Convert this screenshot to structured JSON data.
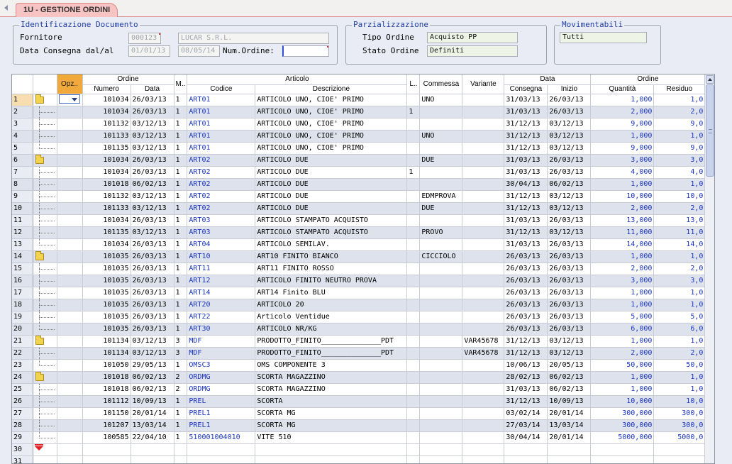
{
  "tab": {
    "title": "1U - GESTIONE ORDINI"
  },
  "ident": {
    "legend": "Identificazione Documento",
    "fornitore_label": "Fornitore",
    "fornitore_code": "000123",
    "fornitore_name": "LUCAR S.R.L.",
    "data_label": "Data Consegna dal/al",
    "data_dal": "01/01/13",
    "data_al": "08/05/14",
    "num_ordine_label": "Num.Ordine:",
    "num_ordine": ""
  },
  "parz": {
    "legend": "Parzializzazione",
    "tipo_label": "Tipo Ordine",
    "tipo_value": "Acquisto PP",
    "stato_label": "Stato Ordine",
    "stato_value": "Definiti"
  },
  "mov": {
    "legend": "Movimentabili",
    "value": "Tutti"
  },
  "grid": {
    "group_headers": {
      "ordine": "Ordine",
      "m": "M..",
      "articolo": "Articolo",
      "l": "L..",
      "commessa": "Commessa",
      "variante": "Variante",
      "data": "Data",
      "ordine2": "Ordine"
    },
    "headers": {
      "opz": "Opz..",
      "numero": "Numero",
      "data": "Data",
      "codice": "Codice",
      "descrizione": "Descrizione",
      "consegna": "Consegna",
      "inizio": "Inizio",
      "quantita": "Quantità",
      "residuo": "Residuo"
    },
    "rows": [
      {
        "n": "1",
        "folder": true,
        "numero": "101034",
        "data": "26/03/13",
        "m": "1",
        "codice": "ART01",
        "descr": "ARTICOLO UNO, CIOE' PRIMO",
        "l": "",
        "commessa": "UNO",
        "variante": "",
        "consegna": "31/03/13",
        "inizio": "26/03/13",
        "qta": "1,000",
        "res": "1,0"
      },
      {
        "n": "2",
        "folder": false,
        "numero": "101034",
        "data": "26/03/13",
        "m": "1",
        "codice": "ART01",
        "descr": "ARTICOLO UNO, CIOE' PRIMO",
        "l": "1",
        "commessa": "",
        "variante": "",
        "consegna": "31/03/13",
        "inizio": "26/03/13",
        "qta": "2,000",
        "res": "2,0"
      },
      {
        "n": "3",
        "folder": false,
        "numero": "101132",
        "data": "03/12/13",
        "m": "1",
        "codice": "ART01",
        "descr": "ARTICOLO UNO, CIOE' PRIMO",
        "l": "",
        "commessa": "",
        "variante": "",
        "consegna": "31/12/13",
        "inizio": "03/12/13",
        "qta": "9,000",
        "res": "9,0"
      },
      {
        "n": "4",
        "folder": false,
        "numero": "101133",
        "data": "03/12/13",
        "m": "1",
        "codice": "ART01",
        "descr": "ARTICOLO UNO, CIOE' PRIMO",
        "l": "",
        "commessa": "UNO",
        "variante": "",
        "consegna": "31/12/13",
        "inizio": "03/12/13",
        "qta": "1,000",
        "res": "1,0"
      },
      {
        "n": "5",
        "folder": false,
        "numero": "101135",
        "data": "03/12/13",
        "m": "1",
        "codice": "ART01",
        "descr": "ARTICOLO UNO, CIOE' PRIMO",
        "l": "",
        "commessa": "",
        "variante": "",
        "consegna": "31/12/13",
        "inizio": "03/12/13",
        "qta": "9,000",
        "res": "9,0"
      },
      {
        "n": "6",
        "folder": true,
        "numero": "101034",
        "data": "26/03/13",
        "m": "1",
        "codice": "ART02",
        "descr": "ARTICOLO DUE",
        "l": "",
        "commessa": "DUE",
        "variante": "",
        "consegna": "31/03/13",
        "inizio": "26/03/13",
        "qta": "3,000",
        "res": "3,0"
      },
      {
        "n": "7",
        "folder": false,
        "numero": "101034",
        "data": "26/03/13",
        "m": "1",
        "codice": "ART02",
        "descr": "ARTICOLO DUE",
        "l": "1",
        "commessa": "",
        "variante": "",
        "consegna": "31/03/13",
        "inizio": "26/03/13",
        "qta": "4,000",
        "res": "4,0"
      },
      {
        "n": "8",
        "folder": false,
        "numero": "101018",
        "data": "06/02/13",
        "m": "1",
        "codice": "ART02",
        "descr": "ARTICOLO DUE",
        "l": "",
        "commessa": "",
        "variante": "",
        "consegna": "30/04/13",
        "inizio": "06/02/13",
        "qta": "1,000",
        "res": "1,0"
      },
      {
        "n": "9",
        "folder": false,
        "numero": "101132",
        "data": "03/12/13",
        "m": "1",
        "codice": "ART02",
        "descr": "ARTICOLO DUE",
        "l": "",
        "commessa": "EDMPROVA",
        "variante": "",
        "consegna": "31/12/13",
        "inizio": "03/12/13",
        "qta": "10,000",
        "res": "10,0"
      },
      {
        "n": "10",
        "folder": false,
        "numero": "101133",
        "data": "03/12/13",
        "m": "1",
        "codice": "ART02",
        "descr": "ARTICOLO DUE",
        "l": "",
        "commessa": "DUE",
        "variante": "",
        "consegna": "31/12/13",
        "inizio": "03/12/13",
        "qta": "2,000",
        "res": "2,0"
      },
      {
        "n": "11",
        "folder": false,
        "numero": "101034",
        "data": "26/03/13",
        "m": "1",
        "codice": "ART03",
        "descr": "ARTICOLO STAMPATO ACQUISTO",
        "l": "",
        "commessa": "",
        "variante": "",
        "consegna": "31/03/13",
        "inizio": "26/03/13",
        "qta": "13,000",
        "res": "13,0"
      },
      {
        "n": "12",
        "folder": false,
        "numero": "101135",
        "data": "03/12/13",
        "m": "1",
        "codice": "ART03",
        "descr": "ARTICOLO STAMPATO ACQUISTO",
        "l": "",
        "commessa": "PROVO",
        "variante": "",
        "consegna": "31/12/13",
        "inizio": "03/12/13",
        "qta": "11,000",
        "res": "11,0"
      },
      {
        "n": "13",
        "folder": false,
        "numero": "101034",
        "data": "26/03/13",
        "m": "1",
        "codice": "ART04",
        "descr": "ARTICOLO SEMILAV.",
        "l": "",
        "commessa": "",
        "variante": "",
        "consegna": "31/03/13",
        "inizio": "26/03/13",
        "qta": "14,000",
        "res": "14,0"
      },
      {
        "n": "14",
        "folder": true,
        "numero": "101035",
        "data": "26/03/13",
        "m": "1",
        "codice": "ART10",
        "descr": "ART10 FINITO BIANCO",
        "l": "",
        "commessa": "CICCIOLO",
        "variante": "",
        "consegna": "26/03/13",
        "inizio": "26/03/13",
        "qta": "1,000",
        "res": "1,0"
      },
      {
        "n": "15",
        "folder": false,
        "numero": "101035",
        "data": "26/03/13",
        "m": "1",
        "codice": "ART11",
        "descr": "ART11 FINITO ROSSO",
        "l": "",
        "commessa": "",
        "variante": "",
        "consegna": "26/03/13",
        "inizio": "26/03/13",
        "qta": "2,000",
        "res": "2,0"
      },
      {
        "n": "16",
        "folder": false,
        "numero": "101035",
        "data": "26/03/13",
        "m": "1",
        "codice": "ART12",
        "descr": "ARTICOLO FINITO NEUTRO PROVA",
        "l": "",
        "commessa": "",
        "variante": "",
        "consegna": "26/03/13",
        "inizio": "26/03/13",
        "qta": "3,000",
        "res": "3,0"
      },
      {
        "n": "17",
        "folder": false,
        "numero": "101035",
        "data": "26/03/13",
        "m": "1",
        "codice": "ART14",
        "descr": "ART14 Finito BLU",
        "l": "",
        "commessa": "",
        "variante": "",
        "consegna": "26/03/13",
        "inizio": "26/03/13",
        "qta": "1,000",
        "res": "1,0"
      },
      {
        "n": "18",
        "folder": false,
        "numero": "101035",
        "data": "26/03/13",
        "m": "1",
        "codice": "ART20",
        "descr": "ARTICOLO 20",
        "l": "",
        "commessa": "",
        "variante": "",
        "consegna": "26/03/13",
        "inizio": "26/03/13",
        "qta": "1,000",
        "res": "1,0"
      },
      {
        "n": "19",
        "folder": false,
        "numero": "101035",
        "data": "26/03/13",
        "m": "1",
        "codice": "ART22",
        "descr": "Articolo Ventidue",
        "l": "",
        "commessa": "",
        "variante": "",
        "consegna": "26/03/13",
        "inizio": "26/03/13",
        "qta": "5,000",
        "res": "5,0"
      },
      {
        "n": "20",
        "folder": false,
        "numero": "101035",
        "data": "26/03/13",
        "m": "1",
        "codice": "ART30",
        "descr": "ARTICOLO NR/KG",
        "l": "",
        "commessa": "",
        "variante": "",
        "consegna": "26/03/13",
        "inizio": "26/03/13",
        "qta": "6,000",
        "res": "6,0"
      },
      {
        "n": "21",
        "folder": true,
        "numero": "101134",
        "data": "03/12/13",
        "m": "3",
        "codice": "MDF",
        "descr": "PRODOTTO_FINITO______________PDT",
        "l": "",
        "commessa": "",
        "variante": "VAR45678",
        "consegna": "31/12/13",
        "inizio": "03/12/13",
        "qta": "1,000",
        "res": "1,0"
      },
      {
        "n": "22",
        "folder": false,
        "numero": "101134",
        "data": "03/12/13",
        "m": "3",
        "codice": "MDF",
        "descr": "PRODOTTO_FINITO______________PDT",
        "l": "",
        "commessa": "",
        "variante": "VAR45678",
        "consegna": "31/12/13",
        "inizio": "03/12/13",
        "qta": "2,000",
        "res": "2,0"
      },
      {
        "n": "23",
        "folder": false,
        "numero": "101050",
        "data": "29/05/13",
        "m": "1",
        "codice": "OMSC3",
        "descr": "OMS COMPONENTE 3",
        "l": "",
        "commessa": "",
        "variante": "",
        "consegna": "10/06/13",
        "inizio": "20/05/13",
        "qta": "50,000",
        "res": "50,0"
      },
      {
        "n": "24",
        "folder": true,
        "numero": "101018",
        "data": "06/02/13",
        "m": "2",
        "codice": "ORDMG",
        "descr": "SCORTA MAGAZZINO",
        "l": "",
        "commessa": "",
        "variante": "",
        "consegna": "28/02/13",
        "inizio": "06/02/13",
        "qta": "1,000",
        "res": "1,0"
      },
      {
        "n": "25",
        "folder": false,
        "numero": "101018",
        "data": "06/02/13",
        "m": "2",
        "codice": "ORDMG",
        "descr": "SCORTA MAGAZZINO",
        "l": "",
        "commessa": "",
        "variante": "",
        "consegna": "31/03/13",
        "inizio": "06/02/13",
        "qta": "1,000",
        "res": "1,0"
      },
      {
        "n": "26",
        "folder": false,
        "numero": "101112",
        "data": "10/09/13",
        "m": "1",
        "codice": "PREL",
        "descr": "SCORTA",
        "l": "",
        "commessa": "",
        "variante": "",
        "consegna": "31/12/13",
        "inizio": "10/09/13",
        "qta": "10,000",
        "res": "10,0"
      },
      {
        "n": "27",
        "folder": false,
        "numero": "101150",
        "data": "20/01/14",
        "m": "1",
        "codice": "PREL1",
        "descr": "SCORTA MG",
        "l": "",
        "commessa": "",
        "variante": "",
        "consegna": "03/02/14",
        "inizio": "20/01/14",
        "qta": "300,000",
        "res": "300,0"
      },
      {
        "n": "28",
        "folder": false,
        "numero": "101207",
        "data": "13/03/14",
        "m": "1",
        "codice": "PREL1",
        "descr": "SCORTA MG",
        "l": "",
        "commessa": "",
        "variante": "",
        "consegna": "27/03/14",
        "inizio": "13/03/14",
        "qta": "300,000",
        "res": "300,0"
      },
      {
        "n": "29",
        "folder": false,
        "numero": "100585",
        "data": "22/04/10",
        "m": "1",
        "codice": "510001004010",
        "descr": "VITE 510",
        "l": "",
        "commessa": "",
        "variante": "",
        "consegna": "30/04/14",
        "inizio": "20/01/14",
        "qta": "5000,000",
        "res": "5000,0"
      }
    ],
    "new_row_number": "30",
    "empty_row_number": "31"
  }
}
